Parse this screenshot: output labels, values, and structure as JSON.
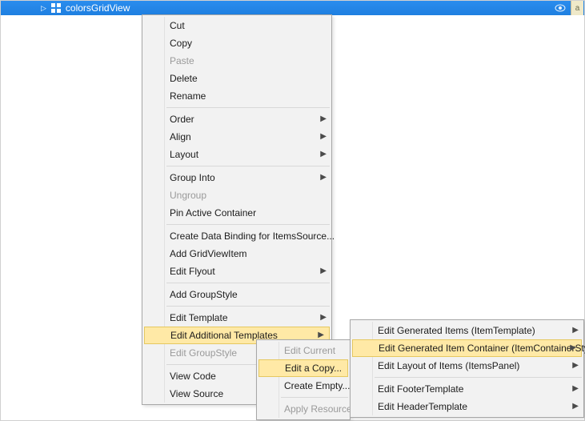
{
  "tree": {
    "item_label": "colorsGridView",
    "lock_label": "a"
  },
  "m1": {
    "cut": "Cut",
    "copy": "Copy",
    "paste": "Paste",
    "del": "Delete",
    "rename": "Rename",
    "order": "Order",
    "align": "Align",
    "layout": "Layout",
    "group_into": "Group Into",
    "ungroup": "Ungroup",
    "pin": "Pin Active Container",
    "binding": "Create Data Binding for ItemsSource...",
    "add_gvi": "Add GridViewItem",
    "edit_flyout": "Edit Flyout",
    "add_groupstyle": "Add GroupStyle",
    "edit_template": "Edit Template",
    "edit_addl": "Edit Additional Templates",
    "edit_groupstyle": "Edit GroupStyle",
    "view_code": "View Code",
    "view_source": "View Source"
  },
  "m2": {
    "edit_current": "Edit Current",
    "edit_copy": "Edit a Copy...",
    "create_empty": "Create Empty...",
    "apply_resource": "Apply Resource"
  },
  "m3": {
    "gen_items": "Edit Generated Items (ItemTemplate)",
    "gen_container": "Edit Generated Item Container (ItemContainerStyle)",
    "layout_items": "Edit Layout of Items (ItemsPanel)",
    "footer": "Edit FooterTemplate",
    "header": "Edit HeaderTemplate"
  }
}
